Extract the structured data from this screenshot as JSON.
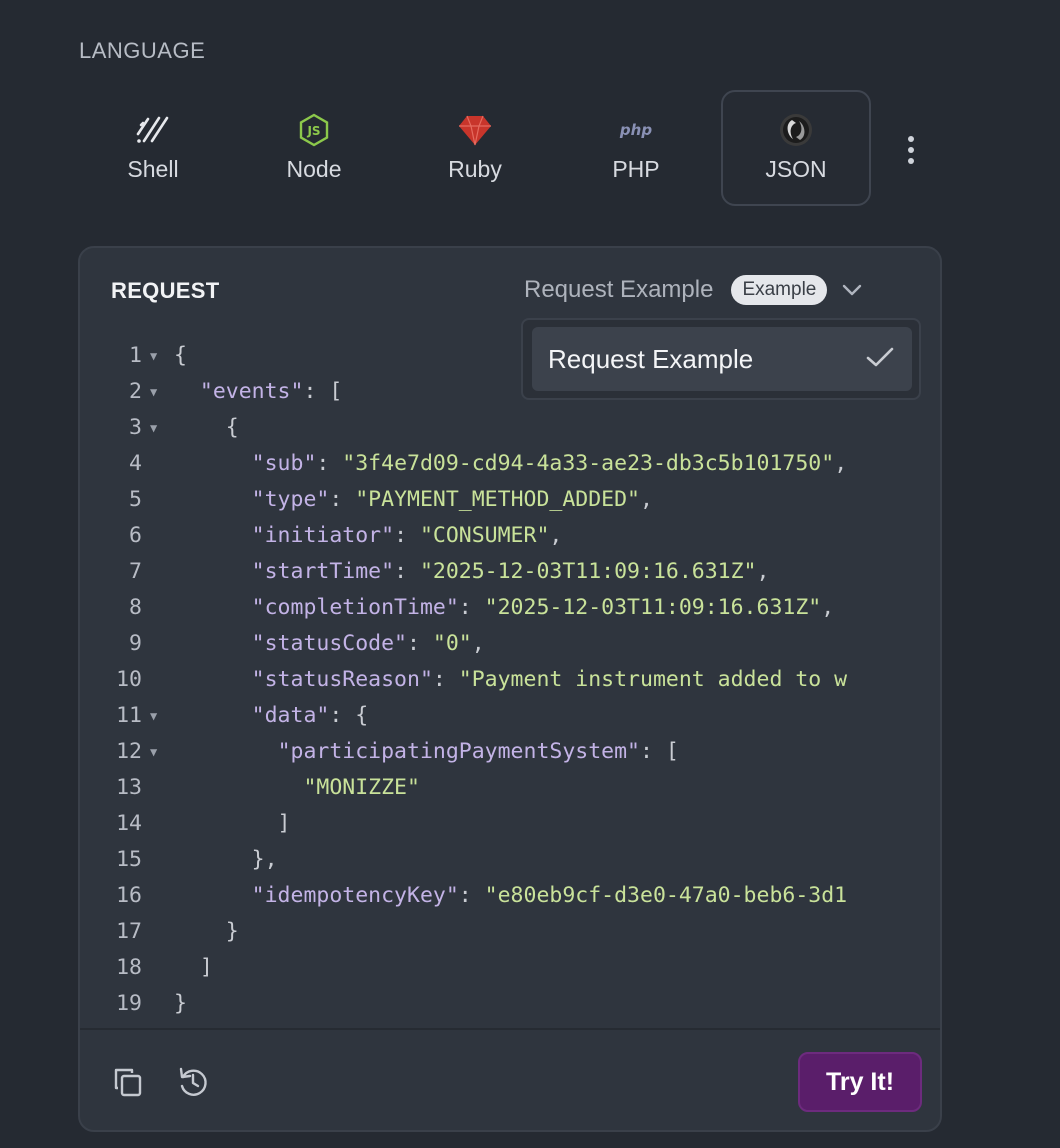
{
  "language": {
    "label": "LANGUAGE",
    "tabs": [
      {
        "name": "Shell",
        "icon": "shell-icon"
      },
      {
        "name": "Node",
        "icon": "nodejs-icon"
      },
      {
        "name": "Ruby",
        "icon": "ruby-icon"
      },
      {
        "name": "PHP",
        "icon": "php-icon"
      },
      {
        "name": "JSON",
        "icon": "json-icon",
        "active": true
      }
    ],
    "php_logo_text": "php",
    "more_icon": "more-vertical-icon"
  },
  "request": {
    "title": "REQUEST",
    "selected_example": "Request Example",
    "badge": "Example",
    "dropdown": {
      "options": [
        {
          "label": "Request Example",
          "selected": true
        }
      ]
    },
    "code_lines": [
      {
        "n": "1",
        "fold": true,
        "segments": [
          [
            "p",
            "{"
          ]
        ]
      },
      {
        "n": "2",
        "fold": true,
        "segments": [
          [
            "p",
            "  "
          ],
          [
            "k",
            "\"events\""
          ],
          [
            "p",
            ": ["
          ]
        ]
      },
      {
        "n": "3",
        "fold": true,
        "segments": [
          [
            "p",
            "    {"
          ]
        ]
      },
      {
        "n": "4",
        "fold": false,
        "segments": [
          [
            "p",
            "      "
          ],
          [
            "k",
            "\"sub\""
          ],
          [
            "p",
            ": "
          ],
          [
            "s",
            "\"3f4e7d09-cd94-4a33-ae23-db3c5b101750\""
          ],
          [
            "p",
            ","
          ]
        ]
      },
      {
        "n": "5",
        "fold": false,
        "segments": [
          [
            "p",
            "      "
          ],
          [
            "k",
            "\"type\""
          ],
          [
            "p",
            ": "
          ],
          [
            "s",
            "\"PAYMENT_METHOD_ADDED\""
          ],
          [
            "p",
            ","
          ]
        ]
      },
      {
        "n": "6",
        "fold": false,
        "segments": [
          [
            "p",
            "      "
          ],
          [
            "k",
            "\"initiator\""
          ],
          [
            "p",
            ": "
          ],
          [
            "s",
            "\"CONSUMER\""
          ],
          [
            "p",
            ","
          ]
        ]
      },
      {
        "n": "7",
        "fold": false,
        "segments": [
          [
            "p",
            "      "
          ],
          [
            "k",
            "\"startTime\""
          ],
          [
            "p",
            ": "
          ],
          [
            "s",
            "\"2025-12-03T11:09:16.631Z\""
          ],
          [
            "p",
            ","
          ]
        ]
      },
      {
        "n": "8",
        "fold": false,
        "segments": [
          [
            "p",
            "      "
          ],
          [
            "k",
            "\"completionTime\""
          ],
          [
            "p",
            ": "
          ],
          [
            "s",
            "\"2025-12-03T11:09:16.631Z\""
          ],
          [
            "p",
            ","
          ]
        ]
      },
      {
        "n": "9",
        "fold": false,
        "segments": [
          [
            "p",
            "      "
          ],
          [
            "k",
            "\"statusCode\""
          ],
          [
            "p",
            ": "
          ],
          [
            "s",
            "\"0\""
          ],
          [
            "p",
            ","
          ]
        ]
      },
      {
        "n": "10",
        "fold": false,
        "segments": [
          [
            "p",
            "      "
          ],
          [
            "k",
            "\"statusReason\""
          ],
          [
            "p",
            ": "
          ],
          [
            "s",
            "\"Payment instrument added to w"
          ]
        ]
      },
      {
        "n": "11",
        "fold": true,
        "segments": [
          [
            "p",
            "      "
          ],
          [
            "k",
            "\"data\""
          ],
          [
            "p",
            ": {"
          ]
        ]
      },
      {
        "n": "12",
        "fold": true,
        "segments": [
          [
            "p",
            "        "
          ],
          [
            "k",
            "\"participatingPaymentSystem\""
          ],
          [
            "p",
            ": ["
          ]
        ]
      },
      {
        "n": "13",
        "fold": false,
        "segments": [
          [
            "p",
            "          "
          ],
          [
            "s",
            "\"MONIZZE\""
          ]
        ]
      },
      {
        "n": "14",
        "fold": false,
        "segments": [
          [
            "p",
            "        ]"
          ]
        ]
      },
      {
        "n": "15",
        "fold": false,
        "segments": [
          [
            "p",
            "      },"
          ]
        ]
      },
      {
        "n": "16",
        "fold": false,
        "segments": [
          [
            "p",
            "      "
          ],
          [
            "k",
            "\"idempotencyKey\""
          ],
          [
            "p",
            ": "
          ],
          [
            "s",
            "\"e80eb9cf-d3e0-47a0-beb6-3d1"
          ]
        ]
      },
      {
        "n": "17",
        "fold": false,
        "segments": [
          [
            "p",
            "    }"
          ]
        ]
      },
      {
        "n": "18",
        "fold": false,
        "segments": [
          [
            "p",
            "  ]"
          ]
        ]
      },
      {
        "n": "19",
        "fold": false,
        "segments": [
          [
            "p",
            "}"
          ]
        ]
      }
    ],
    "footer": {
      "copy_icon": "copy-icon",
      "reset_icon": "reset-icon",
      "try_label": "Try It!"
    }
  },
  "colors": {
    "background": "#252a32",
    "panel": "#2f353e",
    "key": "#c3b3e6",
    "string": "#c9e29a",
    "try_button": "#5a1e6a",
    "node_green": "#8cc84b",
    "ruby_red": "#c8352b"
  }
}
